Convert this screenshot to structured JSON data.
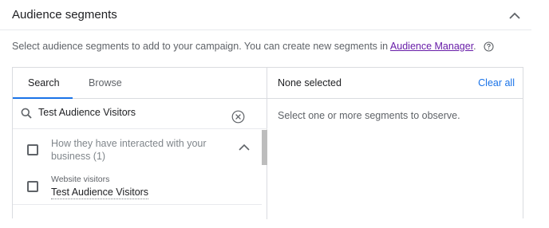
{
  "header": {
    "title": "Audience segments",
    "collapse_icon": "chevron-up-icon"
  },
  "description": {
    "text": "Select audience segments to add to your campaign. You can create new segments in ",
    "link_text": "Audience Manager",
    "suffix": ".",
    "help_icon": "help-circle-icon"
  },
  "tabs": [
    {
      "label": "Search",
      "active": true
    },
    {
      "label": "Browse",
      "active": false
    }
  ],
  "search": {
    "value": "Test Audience Visitors",
    "icon": "search-icon",
    "clear_icon": "clear-circle-icon"
  },
  "results": {
    "group": {
      "label": "How they have interacted with your business (1)",
      "checked": false,
      "expanded": true
    },
    "items": [
      {
        "category": "Website visitors",
        "name": "Test Audience Visitors",
        "checked": false
      }
    ]
  },
  "selected_panel": {
    "title": "None selected",
    "clear_all": "Clear all",
    "empty_message": "Select one or more segments to observe."
  },
  "colors": {
    "accent": "#1a73e8",
    "link": "#681da8",
    "border": "#dadce0"
  }
}
